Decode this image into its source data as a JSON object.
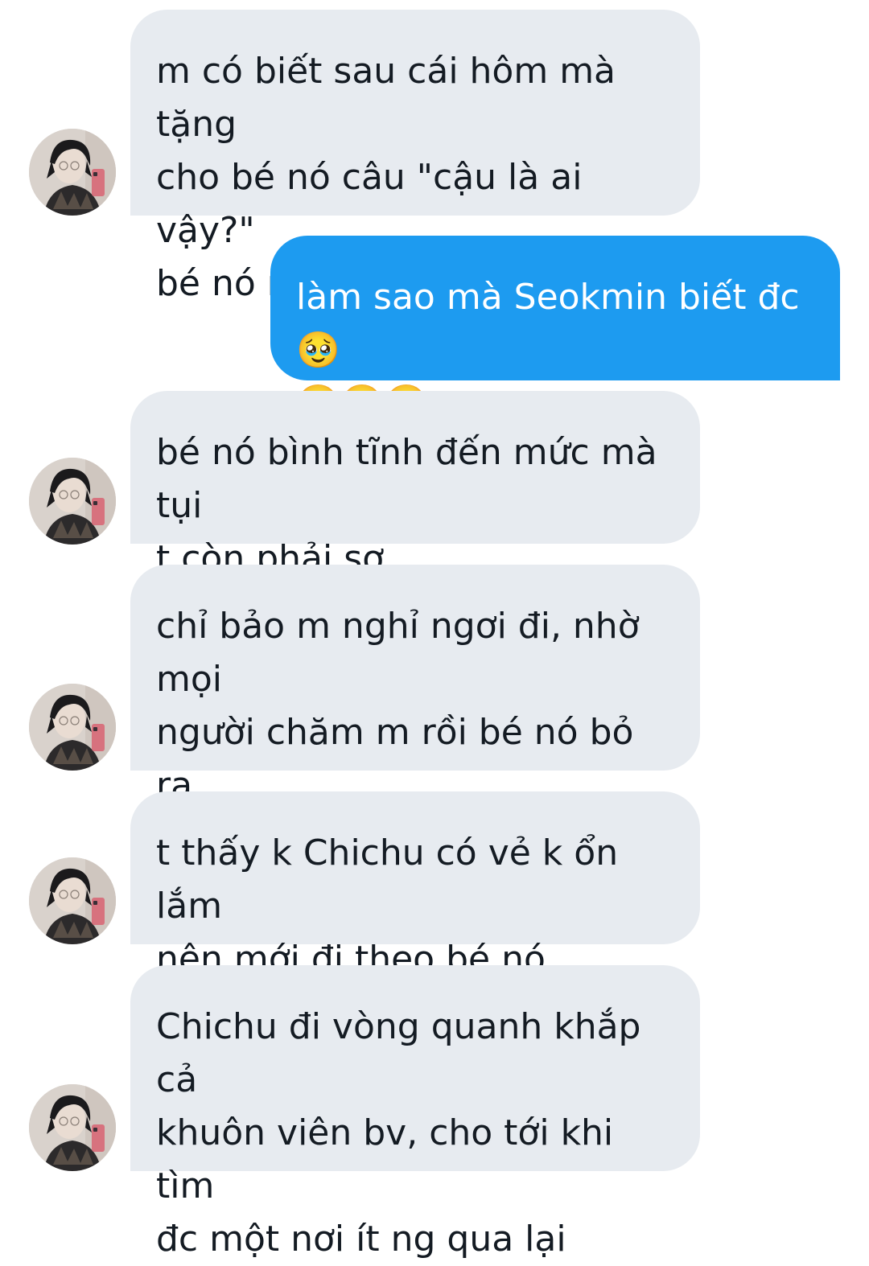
{
  "conversation": {
    "messages": [
      {
        "sender": "them",
        "text": "m có biết sau cái hôm mà tặng\ncho bé nó câu \"cậu là ai vậy?\"\nbé nó như thế nào k?"
      },
      {
        "sender": "me",
        "text": "làm sao mà Seokmin biết đc 🥹\n🥹🥹🥹"
      },
      {
        "sender": "them",
        "text": "bé nó bình tĩnh đến mức mà tụi\nt còn phải sợ"
      },
      {
        "sender": "them",
        "text": "chỉ bảo m nghỉ ngơi đi, nhờ mọi\nngười chăm m rồi bé nó bỏ ra\nngoài"
      },
      {
        "sender": "them",
        "text": "t thấy k Chichu có vẻ k ổn lắm\nnên mới đi theo bé nó"
      },
      {
        "sender": "them",
        "text": "Chichu đi vòng quanh khắp cả\nkhuôn viên bv, cho tới khi tìm\nđc một nơi ít ng qua lại"
      }
    ]
  },
  "colors": {
    "incoming_bubble": "#e7ebf0",
    "outgoing_bubble": "#1d9bf0"
  },
  "icons": {
    "avatar": "user-avatar-photo"
  }
}
